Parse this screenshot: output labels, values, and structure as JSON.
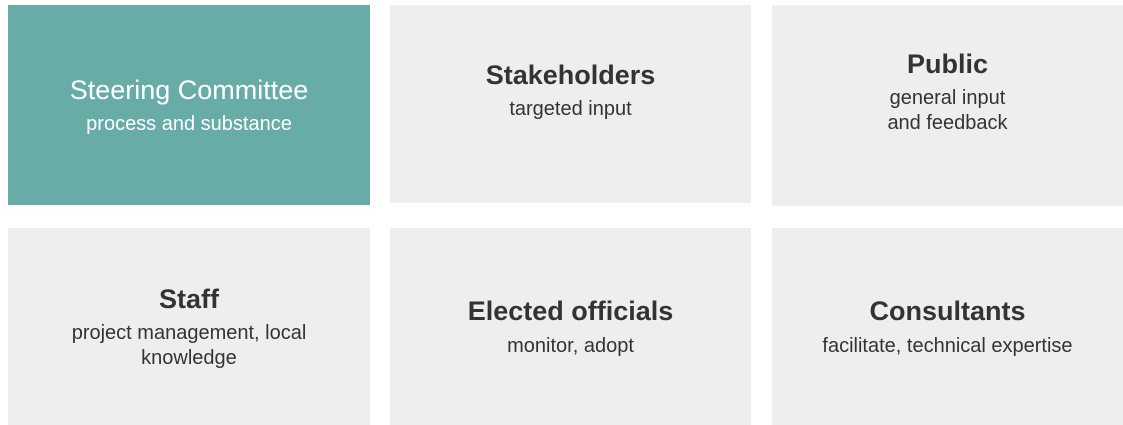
{
  "cards": [
    {
      "title": "Steering Committee",
      "desc": "process and substance"
    },
    {
      "title": "Stakeholders",
      "desc": "targeted input"
    },
    {
      "title": "Public",
      "desc": "general input\nand feedback"
    },
    {
      "title": "Staff",
      "desc": "project management, local\nknowledge"
    },
    {
      "title": "Elected officials",
      "desc": "monitor, adopt"
    },
    {
      "title": "Consultants",
      "desc": "facilitate, technical expertise"
    }
  ],
  "colors": {
    "highlight": "#68aca8",
    "card_bg": "#eeeeee",
    "text": "#333333"
  }
}
